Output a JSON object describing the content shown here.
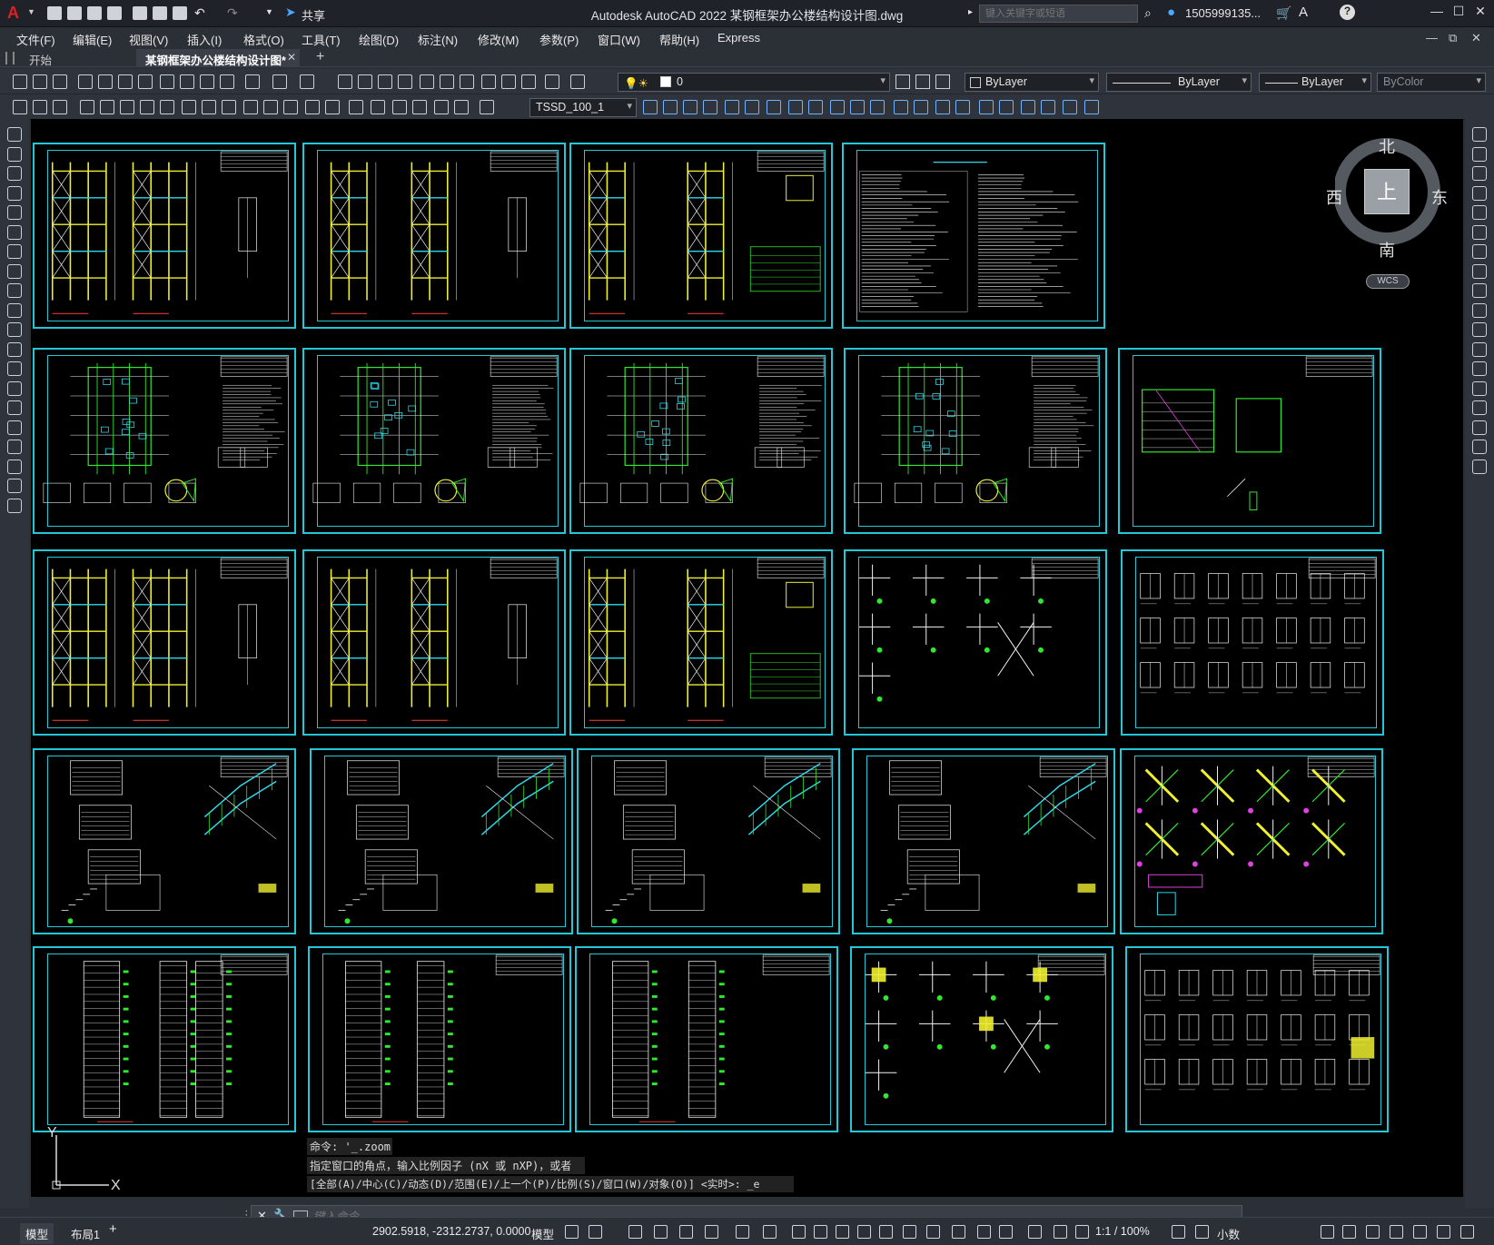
{
  "app": {
    "title": "Autodesk AutoCAD 2022    某钢框架办公楼结构设计图.dwg",
    "search_placeholder": "键入关键字或短语",
    "user": "1505999135...",
    "share_label": "共享"
  },
  "menu": [
    "文件(F)",
    "编辑(E)",
    "视图(V)",
    "插入(I)",
    "格式(O)",
    "工具(T)",
    "绘图(D)",
    "标注(N)",
    "修改(M)",
    "参数(P)",
    "窗口(W)",
    "帮助(H)",
    "Express"
  ],
  "tabs": [
    {
      "label": "开始"
    },
    {
      "label": "某钢框架办公楼结构设计图*"
    }
  ],
  "toolbar": {
    "layer_value": "0",
    "color_value": "ByLayer",
    "linetype_value": "ByLayer",
    "lineweight_value": "ByLayer",
    "plotstyle_value": "ByColor",
    "dimstyle_value": "TSSD_100_1"
  },
  "viewcube": {
    "north": "北",
    "south": "南",
    "east": "东",
    "west": "西",
    "top": "上",
    "wcs": "WCS"
  },
  "command": {
    "history": [
      "命令: '_.zoom",
      "指定窗口的角点，输入比例因子 (nX 或 nXP)，或者",
      "[全部(A)/中心(C)/动态(D)/范围(E)/上一个(P)/比例(S)/窗口(W)/对象(O)] <实时>: _e"
    ],
    "placeholder": "键入命令"
  },
  "layout_tabs": [
    "模型",
    "布局1",
    "+"
  ],
  "status": {
    "coords": "2902.5918, -2312.2737, 0.0000",
    "model": "模型",
    "scale": "1:1 / 100%",
    "units": "小数"
  },
  "colors": {
    "frame": "#20c8d8",
    "yellow": "#f0f030",
    "green": "#30e830",
    "cyan": "#30d8e8",
    "white": "#f4f4f4",
    "magenta": "#e040e0"
  }
}
